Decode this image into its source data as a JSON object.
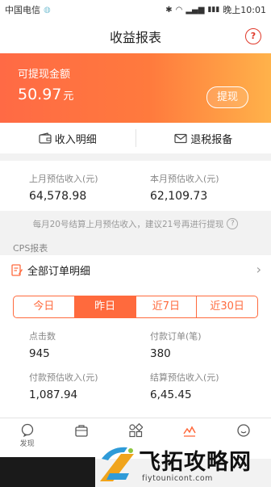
{
  "status_bar": {
    "carrier": "中国电信",
    "battery": "▮▮▮",
    "time": "晚上10:01"
  },
  "header": {
    "title": "收益报表",
    "help_icon": "?"
  },
  "balance_card": {
    "label": "可提现金额",
    "amount": "50.97",
    "unit": "元",
    "withdraw_label": "提现"
  },
  "actions": {
    "income_detail": "收入明细",
    "tax_report": "退税报备"
  },
  "estimates": {
    "last_month_label": "上月预估收入(元)",
    "last_month_value": "64,578.98",
    "this_month_label": "本月预估收入(元)",
    "this_month_value": "62,109.73"
  },
  "note": {
    "text": "每月20号结算上月预估收入，建议21号再进行提现",
    "icon": "?"
  },
  "cps": {
    "title": "CPS报表",
    "all_orders": "全部订单明细",
    "chevron": "›"
  },
  "period_tabs": [
    {
      "label": "今日",
      "active": false
    },
    {
      "label": "昨日",
      "active": true
    },
    {
      "label": "近7日",
      "active": false
    },
    {
      "label": "近30日",
      "active": false
    }
  ],
  "metrics": {
    "clicks_label": "点击数",
    "clicks_value": "945",
    "paid_orders_label": "付款订单(笔)",
    "paid_orders_value": "380",
    "paid_income_label": "付款预估收入(元)",
    "paid_income_value": "1,087.94",
    "settle_income_label": "结算预估收入(元)",
    "settle_income_value": "6,45.45"
  },
  "tabbar": {
    "discover_label": "发现"
  },
  "watermark": {
    "text": "飞拓攻略网",
    "domain": "fiytounicont.com"
  },
  "colors": {
    "accent": "#ff6a3d",
    "gradient_start": "#ff6a45",
    "gradient_end": "#ffb24a",
    "help": "#e0392a"
  }
}
